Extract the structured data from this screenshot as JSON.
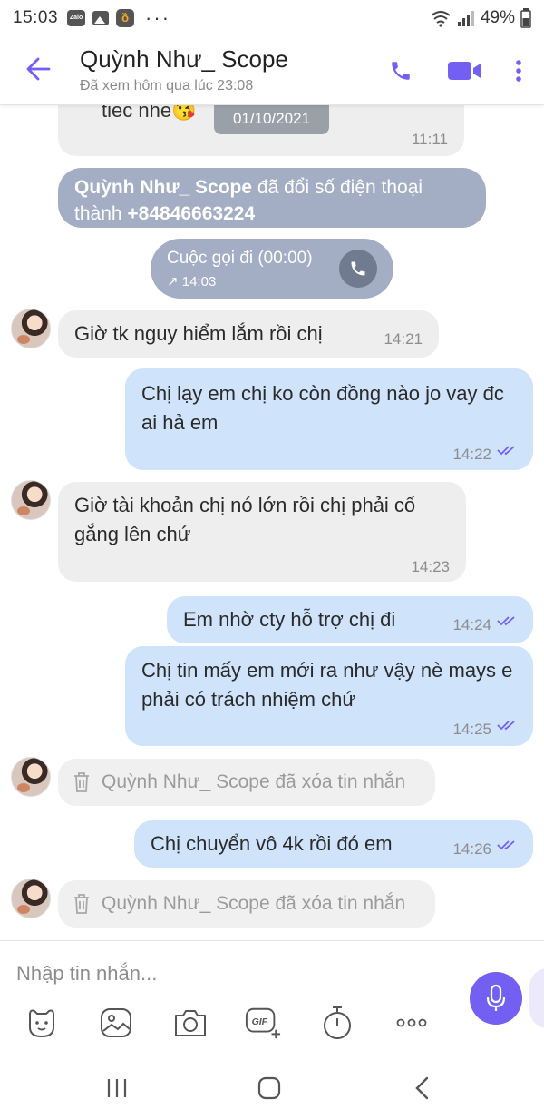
{
  "status_bar": {
    "time": "15:03",
    "battery": "49%",
    "icons": [
      "zalo-icon",
      "gallery-icon",
      "app-icon",
      "more-dots",
      "wifi-icon",
      "signal-icon",
      "battery-icon"
    ]
  },
  "header": {
    "contact_name": "Quỳnh Như_ Scope",
    "contact_status": "Đã xem hôm qua lúc 23:08",
    "accent_color": "#7360f2"
  },
  "chat": {
    "date_pill": "01/10/2021",
    "partial_message": {
      "text": "tiec nhe😘",
      "time": "11:11"
    },
    "system_notice": {
      "name": "Quỳnh Như_ Scope",
      "text": " đã đổi số điện thoại thành ",
      "phone": "+84846663224"
    },
    "call": {
      "label": "Cuộc gọi đi (00:00)",
      "time": "14:03"
    },
    "messages": [
      {
        "dir": "in",
        "text": "Giờ tk nguy hiểm lắm rồi chị",
        "time": "14:21"
      },
      {
        "dir": "out",
        "text": "Chị lạy em chị ko còn đồng nào jo vay đc ai hả em",
        "time": "14:22"
      },
      {
        "dir": "in",
        "text": "Giờ tài khoản chị nó lớn rồi chị phải cố gắng lên chứ",
        "time": "14:23"
      },
      {
        "dir": "out",
        "text": "Em nhờ cty hỗ trợ chị đi",
        "time": "14:24"
      },
      {
        "dir": "out",
        "text": "Chị tin mấy em mới ra như vậy nè mays e phải có trách nhiệm chứ",
        "time": "14:25"
      },
      {
        "dir": "in-deleted",
        "text": "Quỳnh Như_ Scope đã xóa tin nhắn"
      },
      {
        "dir": "out",
        "text": "Chị chuyển vô 4k rồi đó em",
        "time": "14:26"
      },
      {
        "dir": "in-deleted",
        "text": "Quỳnh Như_ Scope đã xóa tin nhắn"
      }
    ]
  },
  "composer": {
    "placeholder": "Nhập tin nhắn...",
    "tools": [
      "sticker-icon",
      "gallery-icon",
      "camera-icon",
      "gif-icon",
      "timer-icon",
      "more-icon"
    ]
  }
}
